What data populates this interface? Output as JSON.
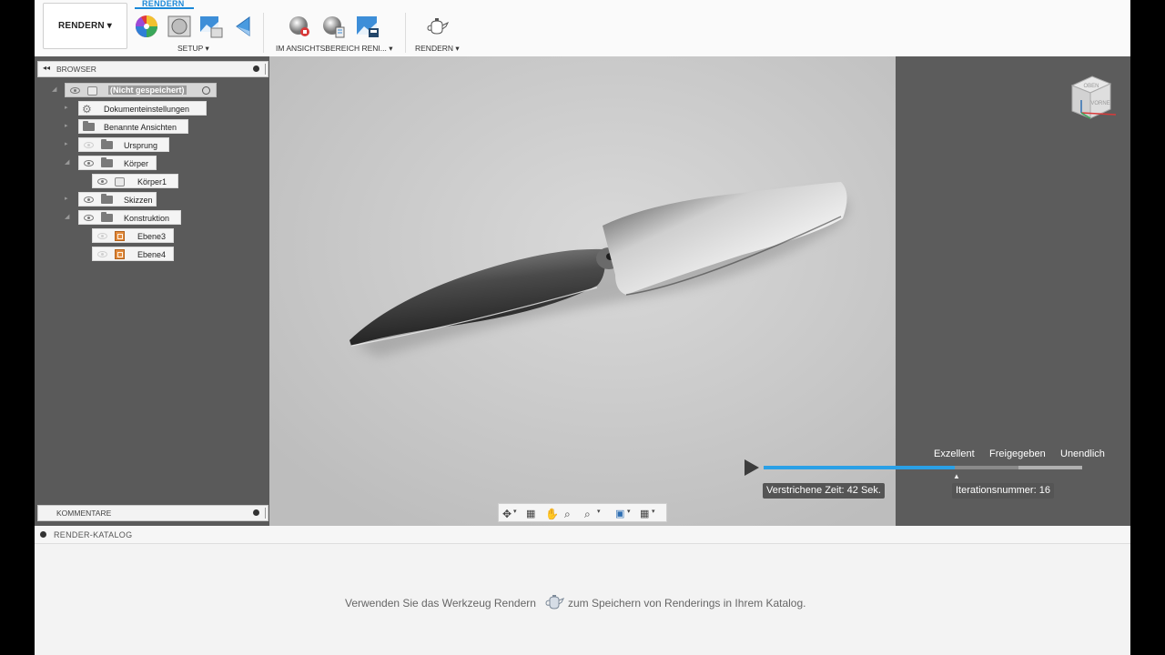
{
  "toolbar": {
    "workspace_label": "RENDERN ▾",
    "active_tab": "RENDERN",
    "groups": {
      "setup": "SETUP ▾",
      "in_canvas": "IM ANSICHTSBEREICH RENI... ▾",
      "render": "RENDERN ▾"
    },
    "icons": [
      "appearance-icon",
      "scene-settings-icon",
      "environment-image-icon",
      "texture-map-icon",
      "in-canvas-render-icon",
      "in-canvas-render-settings-icon",
      "capture-image-icon",
      "teapot-render-icon"
    ]
  },
  "browser": {
    "title": "BROWSER",
    "tree": {
      "root": "(Nicht gespeichert)",
      "doc_settings": "Dokumenteinstellungen",
      "named_views": "Benannte Ansichten",
      "origin": "Ursprung",
      "bodies": "Körper",
      "body1": "Körper1",
      "sketches": "Skizzen",
      "construction": "Konstruktion",
      "plane3": "Ebene3",
      "plane4": "Ebene4"
    }
  },
  "comments": {
    "title": "KOMMENTARE"
  },
  "viewcube": {
    "top": "OBEN",
    "front": "VORNE"
  },
  "render_progress": {
    "quality_levels": [
      "Exzellent",
      "Freigegeben",
      "Unendlich"
    ],
    "elapsed": "Verstrichene Zeit: 42 Sek.",
    "iteration": "Iterationsnummer: 16",
    "progress_fraction": 0.6
  },
  "catalog": {
    "title": "RENDER-KATALOG",
    "msg_before": "Verwenden Sie das Werkzeug Rendern",
    "msg_after": "zum Speichern von Renderings in Ihrem Katalog."
  },
  "colors": {
    "accent": "#1a88d8",
    "progress": "#2aa0e6"
  }
}
